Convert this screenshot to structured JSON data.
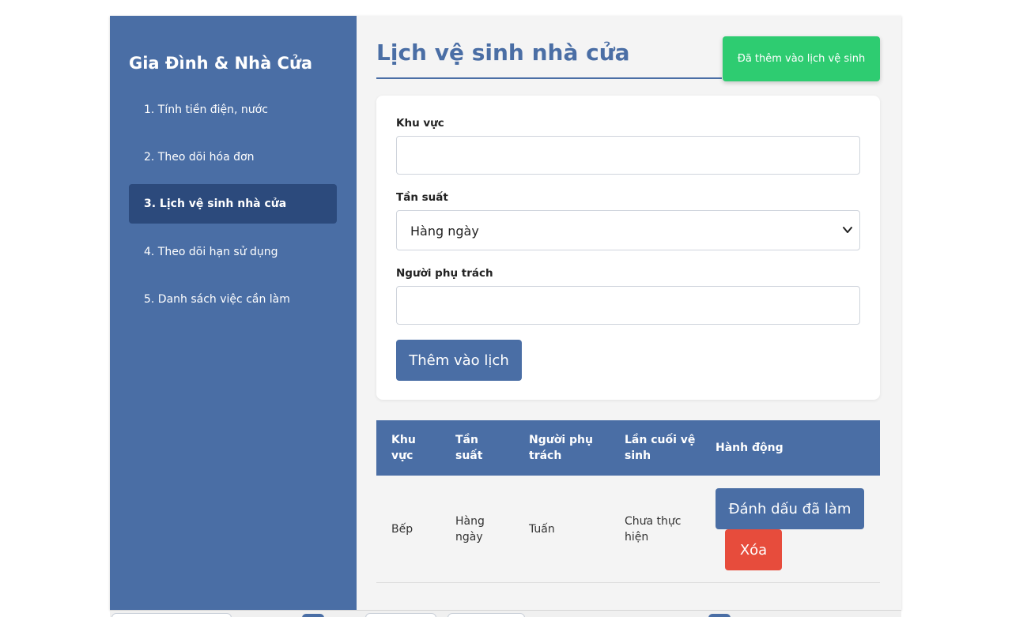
{
  "sidebar": {
    "title": "Gia Đình & Nhà Cửa",
    "items": [
      {
        "label": "1. Tính tiền điện, nước",
        "active": false
      },
      {
        "label": "2. Theo dõi hóa đơn",
        "active": false
      },
      {
        "label": "3. Lịch vệ sinh nhà cửa",
        "active": true
      },
      {
        "label": "4. Theo dõi hạn sử dụng",
        "active": false
      },
      {
        "label": "5. Danh sách việc cần làm",
        "active": false
      }
    ]
  },
  "main": {
    "title": "Lịch vệ sinh nhà cửa",
    "toast": "Đã thêm vào lịch vệ sinh",
    "form": {
      "area_label": "Khu vực",
      "area_value": "",
      "frequency_label": "Tần suất",
      "frequency_value": "Hàng ngày",
      "assignee_label": "Người phụ trách",
      "assignee_value": "",
      "submit_label": "Thêm vào lịch"
    },
    "table": {
      "headers": [
        "Khu vực",
        "Tần suất",
        "Người phụ trách",
        "Lần cuối vệ sinh",
        "Hành động"
      ],
      "rows": [
        {
          "area": "Bếp",
          "frequency": "Hàng ngày",
          "assignee": "Tuấn",
          "last_cleaned": "Chưa thực hiện",
          "mark_label": "Đánh dấu đã làm",
          "delete_label": "Xóa"
        }
      ]
    }
  },
  "colors": {
    "primary": "#4a6ea5",
    "sidebar_active": "#2c4a7c",
    "success": "#2ecc71",
    "danger": "#e74c3c"
  }
}
